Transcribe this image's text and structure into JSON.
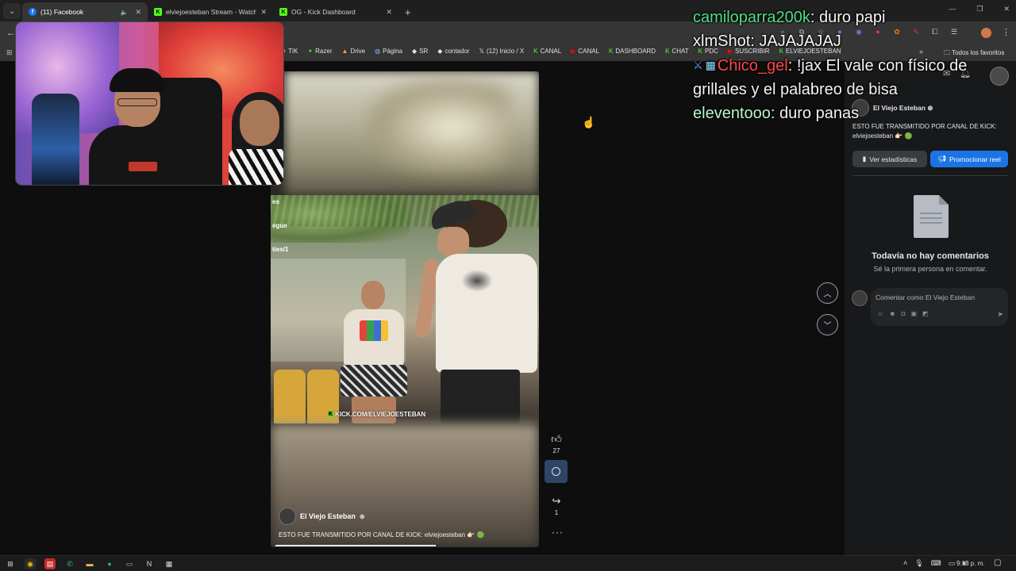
{
  "browser": {
    "tabs": [
      {
        "title": "(11) Facebook",
        "active": true,
        "favicon": "facebook-icon"
      },
      {
        "title": "elviejoesteban Stream - Watch",
        "active": false,
        "favicon": "kick-icon"
      },
      {
        "title": "OG - Kick Dashboard",
        "active": false,
        "favicon": "kick-icon"
      }
    ],
    "bookmarks": [
      "TIK",
      "Razer",
      "Drive",
      "Página",
      "SR",
      "contador",
      "(12) Inicio / X",
      "CANAL",
      "CANAL",
      "DASHBOARD",
      "CHAT",
      "PDC",
      "SUSCRIBIR",
      "ELVIEJOESTEBAN"
    ],
    "all_bookmarks_label": "Todos los favoritos"
  },
  "chat": [
    {
      "user": "camiloparra200k",
      "message": "duro papi",
      "color": "#4ede87"
    },
    {
      "user": "xlmShot",
      "message": "JAJAJAJAJ",
      "color": "#f4f4f4"
    },
    {
      "user": "Chico_gel",
      "message": "!jax El vale con físico de grillales y el palabreo de bisa",
      "color": "#ff4747"
    },
    {
      "user": "eleventooo",
      "message": "duro panas",
      "color": "#b9f7c9"
    }
  ],
  "reel": {
    "author": "El Viejo Esteban",
    "caption": "ESTO FUE TRANSMITIDO POR CANAL DE KICK: elviejoesteban 👉🏻 🟢",
    "watermark": "KICK.COM/ELVIEJOESTEBAN",
    "wall_text": [
      "es",
      "egue",
      "ties/1"
    ],
    "likes": "27",
    "shares": "1",
    "progress_fraction": 0.62
  },
  "panel": {
    "author": "El Viejo Esteban",
    "caption": "ESTO FUE TRANSMITIDO POR CANAL DE KICK: elviejoesteban 👉🏻 🟢",
    "stats_button": "Ver estadísticas",
    "promote_button": "Promocionar reel",
    "empty_title": "Todavía no hay comentarios",
    "empty_subtitle": "Sé la primera persona en comentar.",
    "comment_placeholder": "Comentar como El Viejo Esteban"
  },
  "taskbar": {
    "time": "9:13 p. m."
  },
  "colors": {
    "facebook_blue": "#1b74e4",
    "kick_green": "#53fc18",
    "panel_bg": "#18191a"
  }
}
